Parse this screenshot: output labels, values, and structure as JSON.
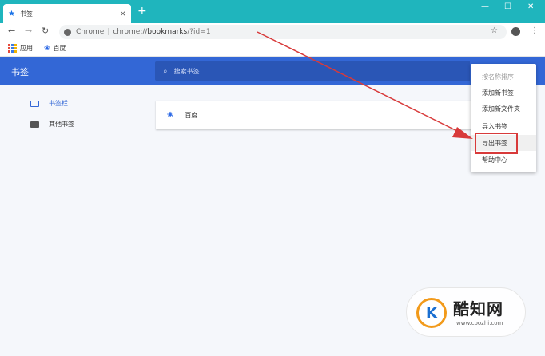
{
  "tab": {
    "title": "书签",
    "close": "×",
    "new_tab": "+"
  },
  "window_controls": {
    "minimize": "—",
    "maximize": "☐",
    "close": "✕"
  },
  "toolbar": {
    "back": "←",
    "forward": "→",
    "reload": "↻"
  },
  "address": {
    "host": "Chrome",
    "separator": "|",
    "scheme": "chrome://",
    "path": "bookmarks",
    "query": "/?id=1"
  },
  "toolbar_right": {
    "star": "☆",
    "menu": "⋮"
  },
  "bookmarks_bar": {
    "apps_label": "应用",
    "items": [
      {
        "label": "百度"
      }
    ]
  },
  "header": {
    "title": "书签",
    "search_placeholder": "搜索书签"
  },
  "sidebar": {
    "items": [
      {
        "label": "书签栏"
      },
      {
        "label": "其他书签"
      }
    ]
  },
  "list": {
    "items": [
      {
        "label": "百度"
      }
    ]
  },
  "menu": {
    "items": [
      {
        "label": "按名称排序"
      },
      {
        "label": "添加新书签"
      },
      {
        "label": "添加新文件夹"
      },
      {
        "label": "导入书签"
      },
      {
        "label": "导出书签"
      },
      {
        "label": "帮助中心"
      }
    ]
  },
  "watermark": {
    "name": "酷知网",
    "site": "www.coozhi.com",
    "logo_letter": "K"
  },
  "colors": {
    "tab_strip": "#1fb5bd",
    "header": "#3367d6",
    "search": "#2a56b6",
    "highlight_box": "#d83a3a",
    "arrow": "#d83a3a"
  }
}
